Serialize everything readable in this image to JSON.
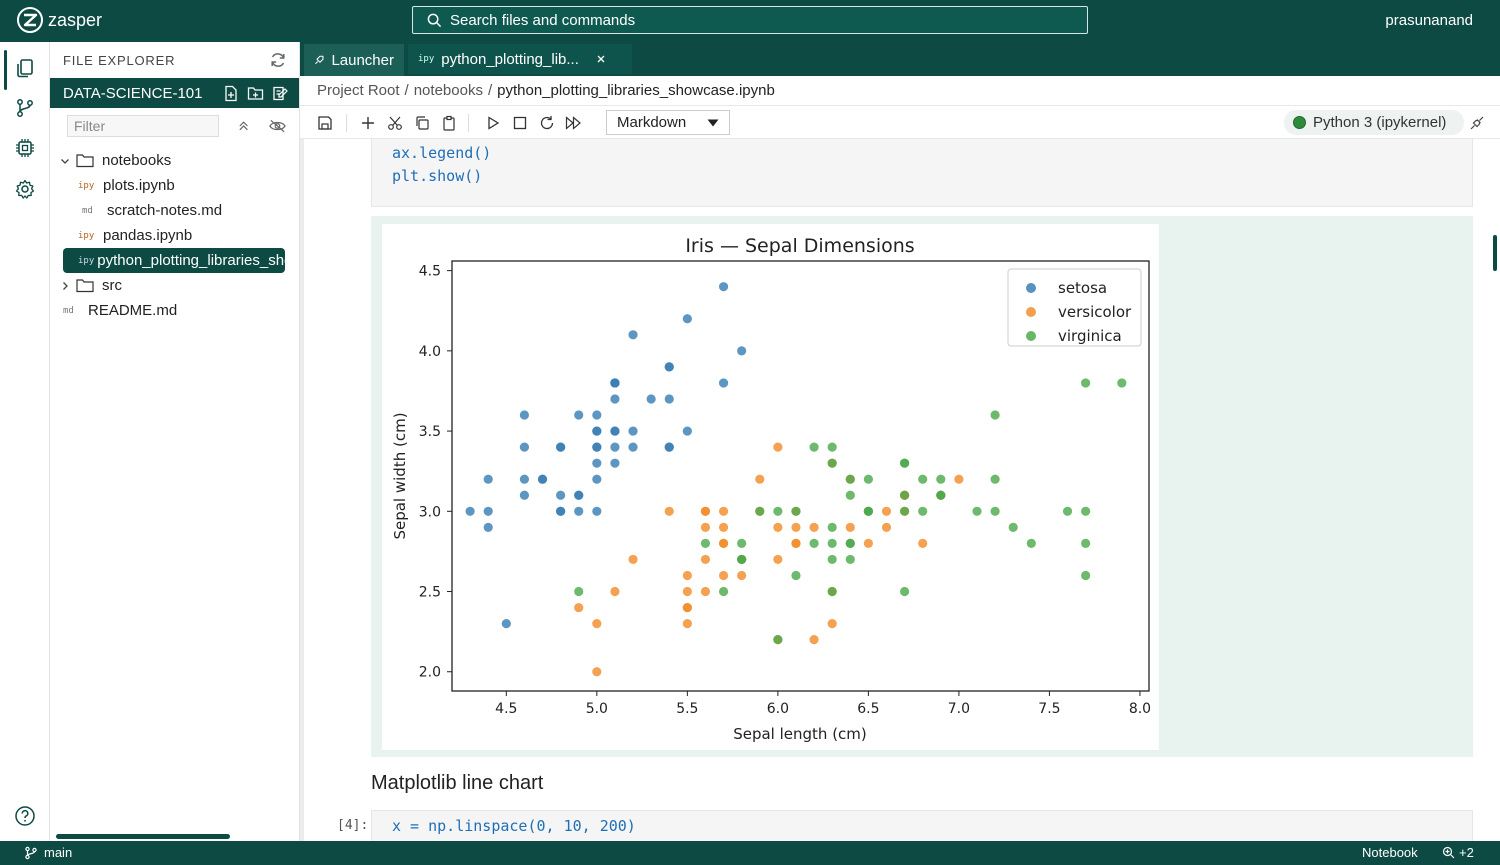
{
  "app": {
    "name": "zasper",
    "user": "prasunanand"
  },
  "search": {
    "placeholder": "Search files and commands"
  },
  "sidebar": {
    "title": "FILE EXPLORER",
    "project": "DATA-SCIENCE-101",
    "filter_placeholder": "Filter",
    "tree": [
      {
        "type": "folder",
        "label": "notebooks",
        "open": true,
        "depth": 0
      },
      {
        "type": "file",
        "tag": "ipy",
        "label": "plots.ipynb",
        "depth": 1
      },
      {
        "type": "file",
        "tag": "md",
        "label": "scratch-notes.md",
        "depth": 1
      },
      {
        "type": "file",
        "tag": "ipy",
        "label": "pandas.ipynb",
        "depth": 1
      },
      {
        "type": "file",
        "tag": "ipy",
        "label": "python_plotting_libraries_showcase.ipynb",
        "depth": 1,
        "active": true
      },
      {
        "type": "folder",
        "label": "src",
        "open": false,
        "depth": 0
      },
      {
        "type": "file",
        "tag": "md",
        "label": "README.md",
        "depth": 0
      }
    ]
  },
  "tabs": [
    {
      "label": "Launcher"
    },
    {
      "tag": "ipy",
      "label": "python_plotting_lib..."
    }
  ],
  "breadcrumb": {
    "root": "Project Root",
    "sep": "/",
    "folder": "notebooks",
    "file": "python_plotting_libraries_showcase.ipynb"
  },
  "toolbar": {
    "cell_type": "Markdown",
    "kernel": "Python 3 (ipykernel)"
  },
  "notebook": {
    "code_top_line1": "ax.legend()",
    "code_top_line2": "plt.show()",
    "md_heading": "Matplotlib line chart",
    "next_prompt": "[4]:",
    "next_code": "x = np.linspace(0, 10, 200)"
  },
  "status": {
    "branch": "main",
    "mode": "Notebook",
    "zoom_extra": "+2"
  },
  "colors": {
    "brand": "#0c4a43",
    "setosa": "#3a7fb5",
    "versicolor": "#f28e2b",
    "virginica": "#4daa4d"
  },
  "chart_data": {
    "type": "scatter",
    "title": "Iris — Sepal Dimensions",
    "xlabel": "Sepal length (cm)",
    "ylabel": "Sepal width (cm)",
    "xlim": [
      4.2,
      8.05
    ],
    "ylim": [
      1.88,
      4.56
    ],
    "xticks": [
      "4.5",
      "5.0",
      "5.5",
      "6.0",
      "6.5",
      "7.0",
      "7.5",
      "8.0"
    ],
    "yticks": [
      "2.0",
      "2.5",
      "3.0",
      "3.5",
      "4.0",
      "4.5"
    ],
    "legend_position": "top-right",
    "series": [
      {
        "name": "setosa",
        "color": "#3a7fb5",
        "points": [
          [
            5.1,
            3.5
          ],
          [
            4.9,
            3.0
          ],
          [
            4.7,
            3.2
          ],
          [
            4.6,
            3.1
          ],
          [
            5.0,
            3.6
          ],
          [
            5.4,
            3.9
          ],
          [
            4.6,
            3.4
          ],
          [
            5.0,
            3.4
          ],
          [
            4.4,
            2.9
          ],
          [
            4.9,
            3.1
          ],
          [
            5.4,
            3.7
          ],
          [
            4.8,
            3.4
          ],
          [
            4.8,
            3.0
          ],
          [
            4.3,
            3.0
          ],
          [
            5.8,
            4.0
          ],
          [
            5.7,
            4.4
          ],
          [
            5.4,
            3.9
          ],
          [
            5.1,
            3.5
          ],
          [
            5.7,
            3.8
          ],
          [
            5.1,
            3.8
          ],
          [
            5.4,
            3.4
          ],
          [
            5.1,
            3.7
          ],
          [
            4.6,
            3.6
          ],
          [
            5.1,
            3.3
          ],
          [
            4.8,
            3.4
          ],
          [
            5.0,
            3.0
          ],
          [
            5.0,
            3.4
          ],
          [
            5.2,
            3.5
          ],
          [
            5.2,
            3.4
          ],
          [
            4.7,
            3.2
          ],
          [
            4.8,
            3.1
          ],
          [
            5.4,
            3.4
          ],
          [
            5.2,
            4.1
          ],
          [
            5.5,
            4.2
          ],
          [
            4.9,
            3.1
          ],
          [
            5.0,
            3.2
          ],
          [
            5.5,
            3.5
          ],
          [
            4.9,
            3.6
          ],
          [
            4.4,
            3.0
          ],
          [
            5.1,
            3.4
          ],
          [
            5.0,
            3.5
          ],
          [
            4.5,
            2.3
          ],
          [
            4.4,
            3.2
          ],
          [
            5.0,
            3.5
          ],
          [
            5.1,
            3.8
          ],
          [
            4.8,
            3.0
          ],
          [
            5.1,
            3.8
          ],
          [
            4.6,
            3.2
          ],
          [
            5.3,
            3.7
          ],
          [
            5.0,
            3.3
          ]
        ]
      },
      {
        "name": "versicolor",
        "color": "#f28e2b",
        "points": [
          [
            7.0,
            3.2
          ],
          [
            6.4,
            3.2
          ],
          [
            6.9,
            3.1
          ],
          [
            5.5,
            2.3
          ],
          [
            6.5,
            2.8
          ],
          [
            5.7,
            2.8
          ],
          [
            6.3,
            3.3
          ],
          [
            4.9,
            2.4
          ],
          [
            6.6,
            2.9
          ],
          [
            5.2,
            2.7
          ],
          [
            5.0,
            2.0
          ],
          [
            5.9,
            3.0
          ],
          [
            6.0,
            2.2
          ],
          [
            6.1,
            2.9
          ],
          [
            5.6,
            2.9
          ],
          [
            6.7,
            3.1
          ],
          [
            5.6,
            3.0
          ],
          [
            5.8,
            2.7
          ],
          [
            6.2,
            2.2
          ],
          [
            5.6,
            2.5
          ],
          [
            5.9,
            3.2
          ],
          [
            6.1,
            2.8
          ],
          [
            6.3,
            2.5
          ],
          [
            6.1,
            2.8
          ],
          [
            6.4,
            2.9
          ],
          [
            6.6,
            3.0
          ],
          [
            6.8,
            2.8
          ],
          [
            6.7,
            3.0
          ],
          [
            6.0,
            2.9
          ],
          [
            5.7,
            2.6
          ],
          [
            5.5,
            2.4
          ],
          [
            5.5,
            2.4
          ],
          [
            5.8,
            2.7
          ],
          [
            6.0,
            2.7
          ],
          [
            5.4,
            3.0
          ],
          [
            6.0,
            3.4
          ],
          [
            6.7,
            3.1
          ],
          [
            6.3,
            2.3
          ],
          [
            5.6,
            3.0
          ],
          [
            5.5,
            2.5
          ],
          [
            5.5,
            2.6
          ],
          [
            6.1,
            3.0
          ],
          [
            5.8,
            2.6
          ],
          [
            5.0,
            2.3
          ],
          [
            5.6,
            2.7
          ],
          [
            5.7,
            3.0
          ],
          [
            5.7,
            2.9
          ],
          [
            6.2,
            2.9
          ],
          [
            5.1,
            2.5
          ],
          [
            5.7,
            2.8
          ]
        ]
      },
      {
        "name": "virginica",
        "color": "#4daa4d",
        "points": [
          [
            6.3,
            3.3
          ],
          [
            5.8,
            2.7
          ],
          [
            7.1,
            3.0
          ],
          [
            6.3,
            2.9
          ],
          [
            6.5,
            3.0
          ],
          [
            7.6,
            3.0
          ],
          [
            4.9,
            2.5
          ],
          [
            7.3,
            2.9
          ],
          [
            6.7,
            2.5
          ],
          [
            7.2,
            3.6
          ],
          [
            6.5,
            3.2
          ],
          [
            6.4,
            2.7
          ],
          [
            6.8,
            3.0
          ],
          [
            5.7,
            2.5
          ],
          [
            5.8,
            2.8
          ],
          [
            6.4,
            3.2
          ],
          [
            6.5,
            3.0
          ],
          [
            7.7,
            3.8
          ],
          [
            7.7,
            2.6
          ],
          [
            6.0,
            2.2
          ],
          [
            6.9,
            3.2
          ],
          [
            5.6,
            2.8
          ],
          [
            7.7,
            2.8
          ],
          [
            6.3,
            2.7
          ],
          [
            6.7,
            3.3
          ],
          [
            7.2,
            3.2
          ],
          [
            6.2,
            2.8
          ],
          [
            6.1,
            3.0
          ],
          [
            6.4,
            2.8
          ],
          [
            7.2,
            3.0
          ],
          [
            7.4,
            2.8
          ],
          [
            7.9,
            3.8
          ],
          [
            6.4,
            2.8
          ],
          [
            6.3,
            2.8
          ],
          [
            6.1,
            2.6
          ],
          [
            7.7,
            3.0
          ],
          [
            6.3,
            3.4
          ],
          [
            6.4,
            3.1
          ],
          [
            6.0,
            3.0
          ],
          [
            6.9,
            3.1
          ],
          [
            6.7,
            3.1
          ],
          [
            6.9,
            3.1
          ],
          [
            5.8,
            2.7
          ],
          [
            6.8,
            3.2
          ],
          [
            6.7,
            3.3
          ],
          [
            6.7,
            3.0
          ],
          [
            6.3,
            2.5
          ],
          [
            6.5,
            3.0
          ],
          [
            6.2,
            3.4
          ],
          [
            5.9,
            3.0
          ]
        ]
      }
    ]
  }
}
